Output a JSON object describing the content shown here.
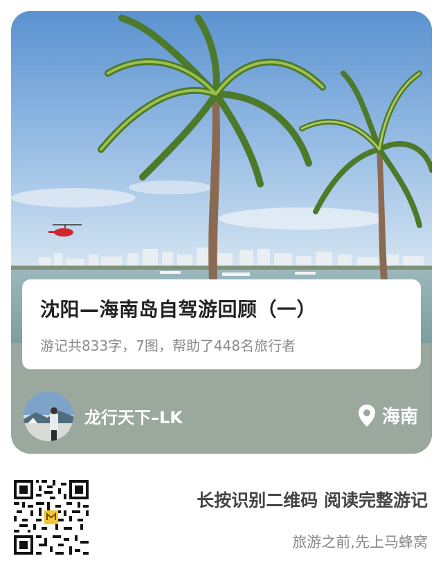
{
  "card": {
    "title": "沈阳—海南岛自驾游回顾（一）",
    "stats": "游记共833字，7图，帮助了448名旅行者",
    "author": "龙行天下–LK",
    "location": "海南",
    "image_description_icon": "beach-palm-photo"
  },
  "bottom": {
    "cta": "长按识别二维码 阅读完整游记",
    "slogan": "旅游之前,先上马蜂窝"
  },
  "colors": {
    "card_footer": "#9aa89e",
    "sky_top": "#5f95cf",
    "sea": "#8fb0b3",
    "accent_logo": "#f7c531"
  }
}
